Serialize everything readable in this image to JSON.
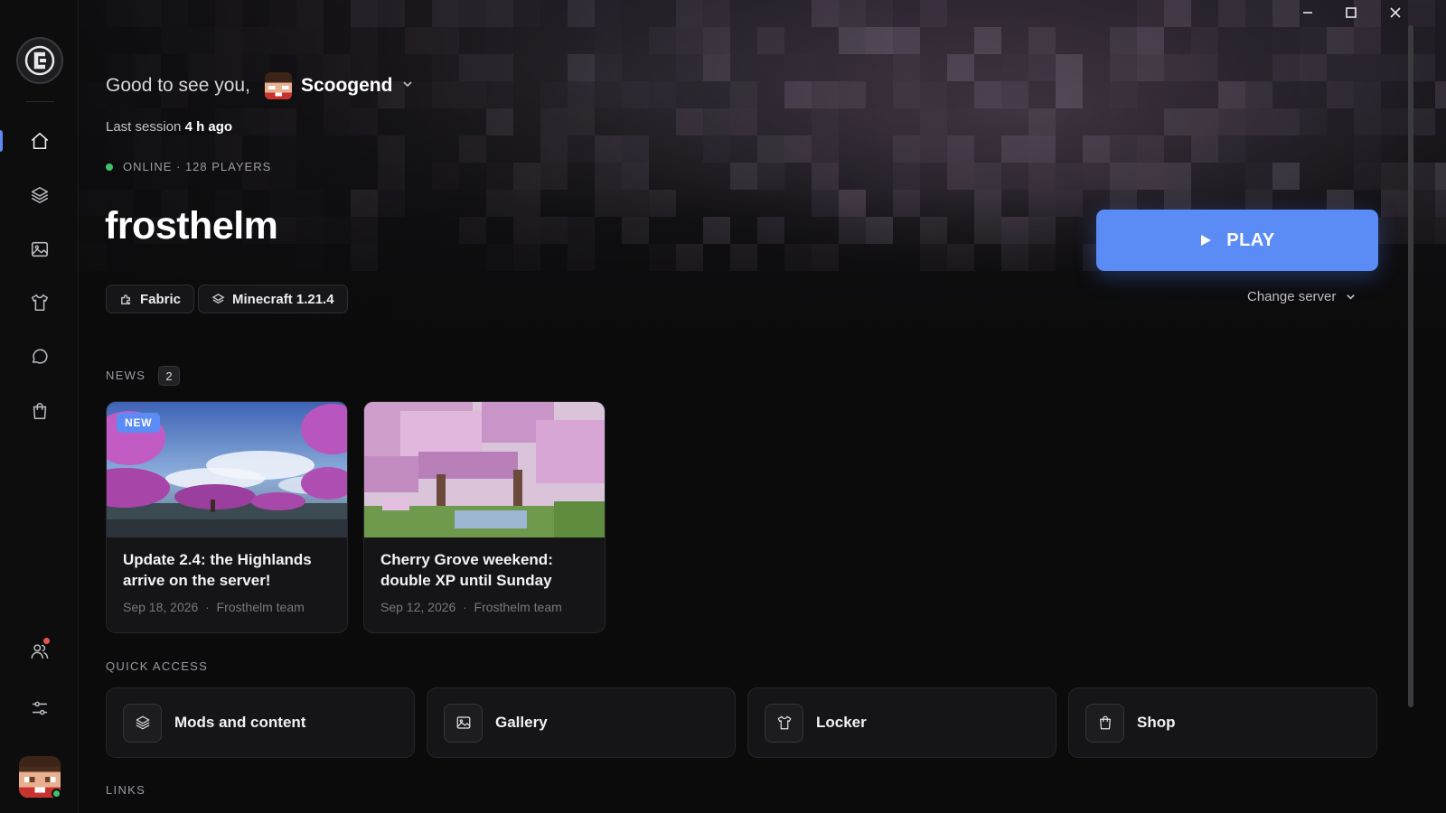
{
  "window": {
    "minimize_icon": "minimize-icon",
    "maximize_icon": "maximize-icon",
    "close_icon": "close-icon"
  },
  "sidebar": {
    "logo_icon": "c-logo-icon",
    "items": [
      {
        "name": "home",
        "icon": "home-icon",
        "active": true
      },
      {
        "name": "mods",
        "icon": "layers-icon",
        "active": false
      },
      {
        "name": "gallery",
        "icon": "image-icon",
        "active": false
      },
      {
        "name": "locker",
        "icon": "shirt-icon",
        "active": false
      },
      {
        "name": "chat",
        "icon": "chat-bubble-icon",
        "active": false
      },
      {
        "name": "shop",
        "icon": "shopping-bag-icon",
        "active": false
      }
    ],
    "bottom_items": [
      {
        "name": "friends",
        "icon": "friends-icon",
        "has_notification": true
      },
      {
        "name": "settings",
        "icon": "sliders-icon"
      }
    ],
    "profile": {
      "status": "online"
    }
  },
  "hero": {
    "greeting": "Good to see you,",
    "username": "Scoogend",
    "last_session_label": "Last session",
    "last_session_value": "4 h ago",
    "status": "ONLINE · 128 PLAYERS",
    "server_name": "frosthelm",
    "tags": [
      {
        "icon": "puzzle-icon",
        "label": "Fabric"
      },
      {
        "icon": "layers-icon",
        "label": "Minecraft 1.21.4"
      }
    ],
    "play_label": "PLAY",
    "change_server_label": "Change server"
  },
  "news": {
    "label": "NEWS",
    "count": "2",
    "items": [
      {
        "badge": "NEW",
        "title": "Update 2.4: the Highlands arrive on the server!",
        "date": "Sep 18, 2026",
        "author": "Frosthelm team"
      },
      {
        "badge": "",
        "title": "Cherry Grove weekend: double XP until Sunday",
        "date": "Sep 12, 2026",
        "author": "Frosthelm team"
      }
    ]
  },
  "quick_access": {
    "label": "QUICK ACCESS",
    "items": [
      {
        "icon": "layers-icon",
        "label": "Mods and content"
      },
      {
        "icon": "image-icon",
        "label": "Gallery"
      },
      {
        "icon": "shirt-icon",
        "label": "Locker"
      },
      {
        "icon": "shopping-bag-icon",
        "label": "Shop"
      }
    ]
  },
  "links": {
    "label": "LINKS"
  },
  "colors": {
    "accent": "#5b8cf6",
    "online": "#3cc46a",
    "background": "#0b0b0c",
    "card": "#151517"
  }
}
